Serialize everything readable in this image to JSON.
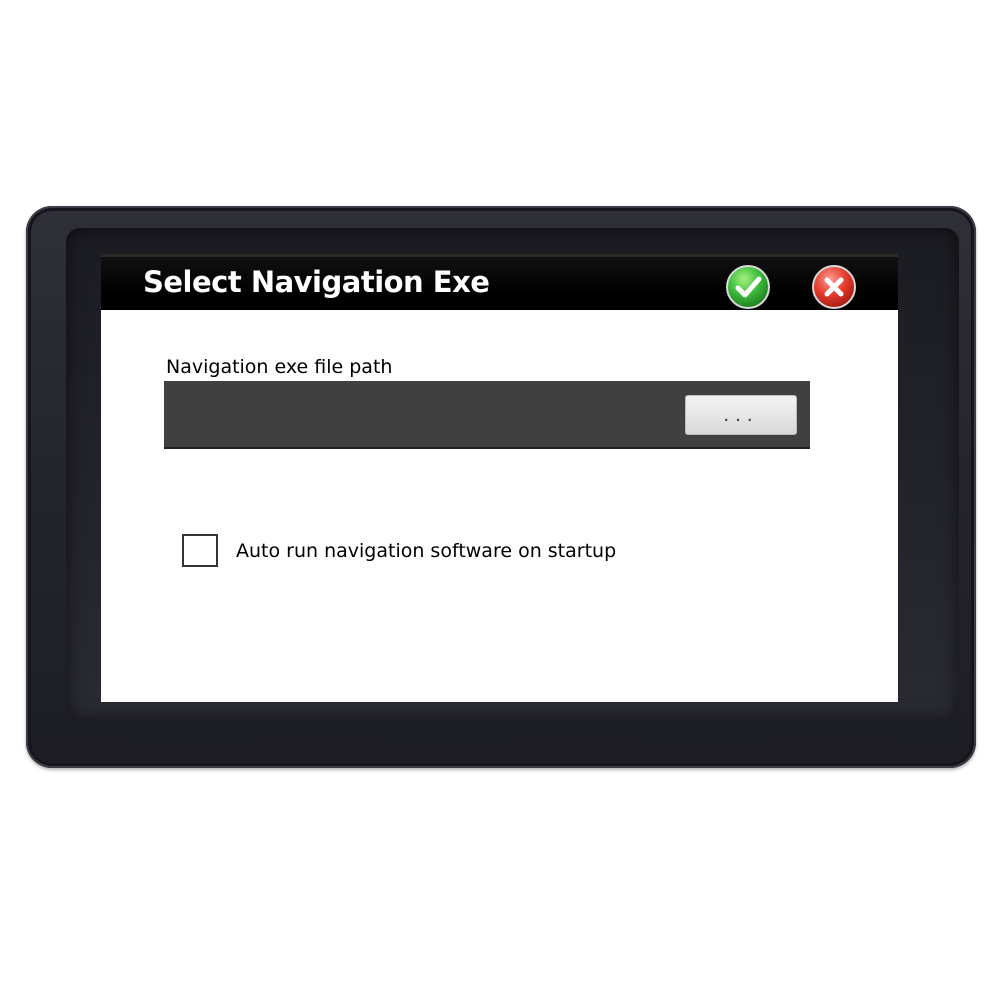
{
  "dialog": {
    "title": "Select Navigation Exe",
    "ok_icon": "checkmark-icon",
    "cancel_icon": "close-icon",
    "colors": {
      "titlebar": "#000000",
      "ok": "#3fbf3f",
      "cancel": "#e23a2a",
      "path_field": "#404040"
    }
  },
  "path": {
    "label": "Navigation exe file path",
    "value": "",
    "browse_label": "..."
  },
  "autorun": {
    "label": "Auto run navigation software on startup",
    "checked": false
  }
}
